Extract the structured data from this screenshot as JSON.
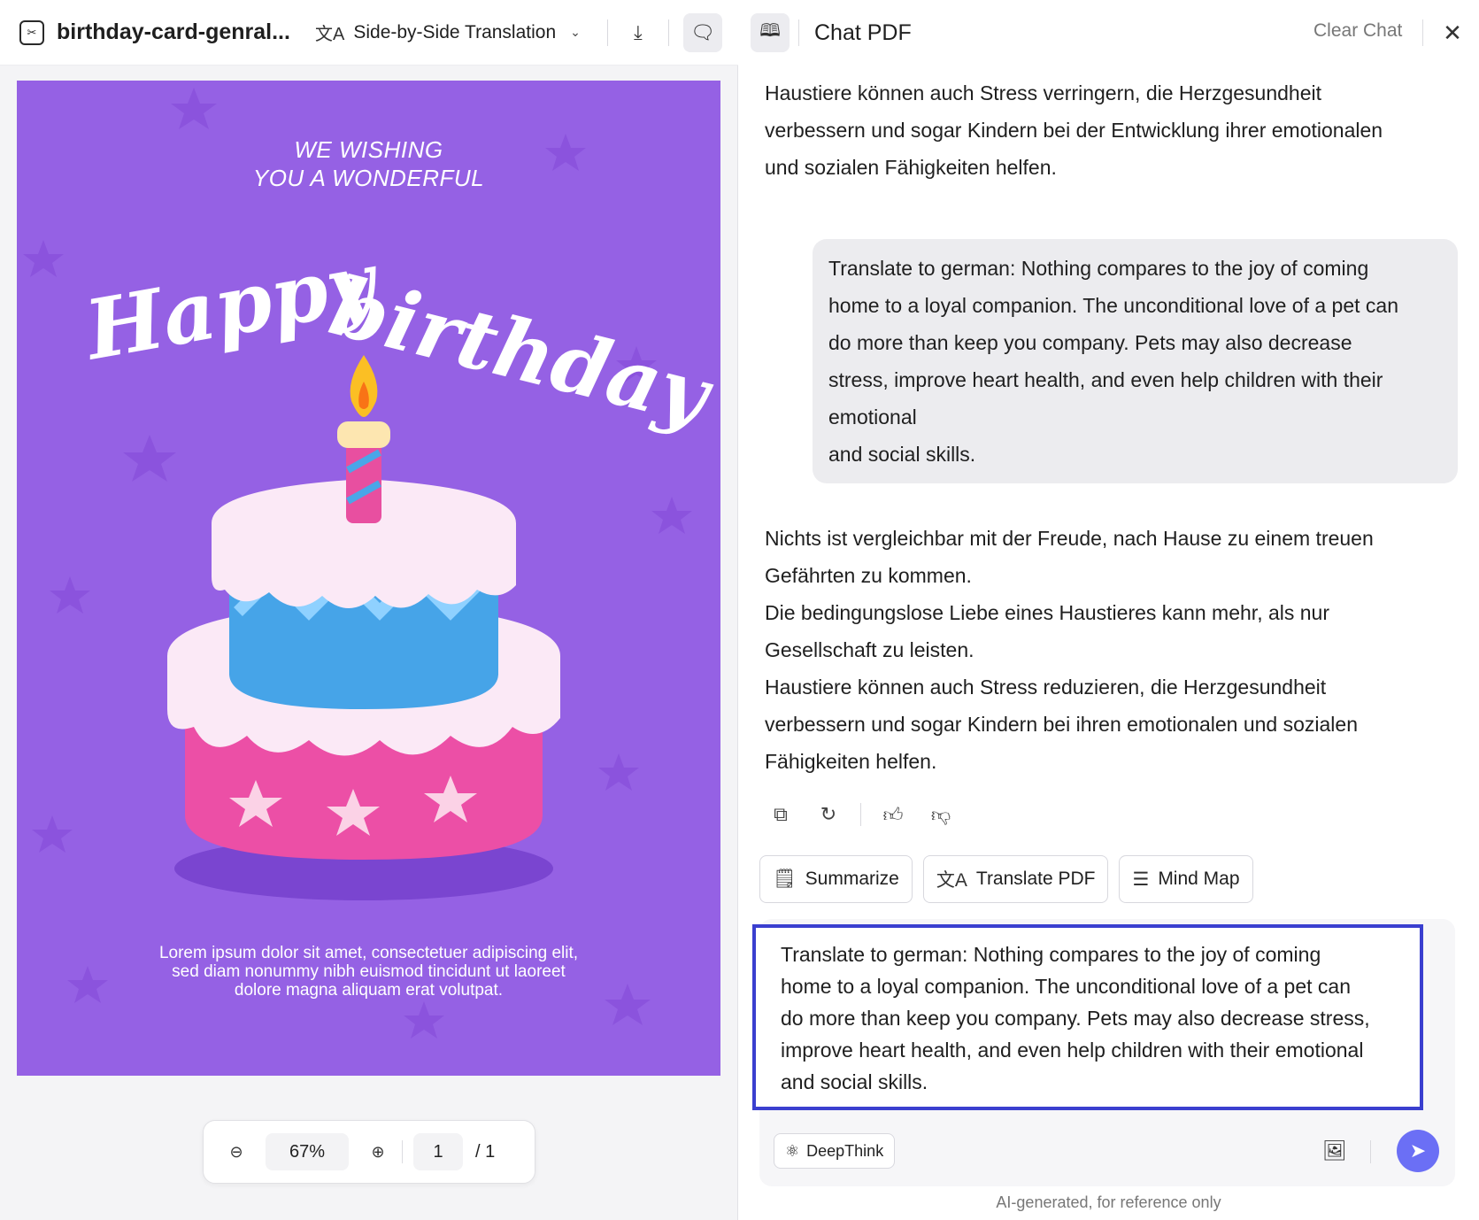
{
  "left_toolbar": {
    "file_name": "birthday-card-genral...",
    "translate_mode": "Side-by-Side Translation"
  },
  "card": {
    "heading_line1": "WE WISHING",
    "heading_line2": "YOU A WONDERFUL",
    "script_word1": "Happy",
    "script_word2": "birthday",
    "body_text": "Lorem ipsum dolor sit amet, consectetuer adipiscing elit, sed diam nonummy nibh euismod tincidunt ut laoreet dolore magna aliquam erat volutpat.",
    "bg_color": "#9561e4"
  },
  "zoom_bar": {
    "zoom_value": "67%",
    "page_current": "1",
    "page_total": "/ 1"
  },
  "chat": {
    "title": "Chat PDF",
    "clear_label": "Clear Chat",
    "prev_answer_tail": [
      "Haustiere können auch Stress verringern, die Herzgesundheit",
      "verbessern und sogar Kindern bei der Entwicklung ihrer emotionalen",
      "und sozialen Fähigkeiten helfen."
    ],
    "user_message": [
      "Translate to german: Nothing compares to the joy of coming",
      "home to a loyal companion. The unconditional love of a pet can",
      "do more than keep you company. Pets may also decrease",
      "stress, improve heart health, and even help children with their",
      "emotional",
      "and social skills."
    ],
    "answer": [
      "Nichts ist vergleichbar mit der Freude, nach Hause zu einem treuen",
      "Gefährten zu kommen.",
      "Die bedingungslose Liebe eines Haustieres kann mehr, als nur",
      "Gesellschaft zu leisten.",
      "Haustiere können auch Stress reduzieren, die Herzgesundheit",
      "verbessern und sogar Kindern bei ihren emotionalen und sozialen",
      "Fähigkeiten helfen."
    ],
    "chips": {
      "summarize": "Summarize",
      "translate": "Translate PDF",
      "mindmap": "Mind Map"
    },
    "input_lines": [
      "Translate to german: Nothing compares to the joy of coming",
      "home to a loyal companion. The unconditional love of a pet can",
      "do more than keep you company. Pets may also decrease stress,",
      "improve heart health, and even help children with their emotional",
      "and social skills."
    ],
    "deepthink_label": "DeepThink",
    "disclaimer": "AI-generated, for reference only",
    "accent_color": "#6b6ff5",
    "highlight_color": "#3a3fcf"
  }
}
